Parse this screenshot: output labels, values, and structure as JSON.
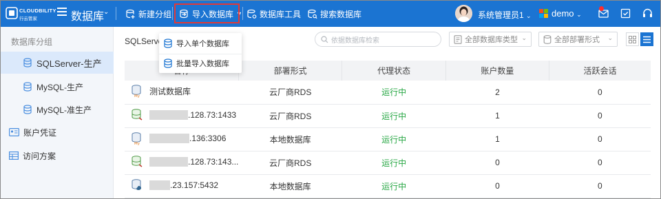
{
  "brand": {
    "name": "CLOUDBILITY",
    "sub": "行云管家"
  },
  "app": {
    "title": "数据库"
  },
  "toolbar": {
    "new_group": "新建分组",
    "import_db": "导入数据库",
    "db_tools": "数据库工具",
    "search_db": "搜索数据库"
  },
  "user": {
    "name": "系统管理员1"
  },
  "tenant": {
    "name": "demo"
  },
  "sidebar": {
    "heading": "数据库分组",
    "groups": [
      {
        "label": "SQLServer-生产"
      },
      {
        "label": "MySQL-生产"
      },
      {
        "label": "MySQL-准生产"
      }
    ],
    "credentials": "账户凭证",
    "access": "访问方案"
  },
  "main": {
    "breadcrumb": "SQLServer-生产",
    "search_placeholder": "依据数据库检索",
    "filter_type": "全部数据库类型",
    "filter_deploy": "全部部署形式"
  },
  "dropdown": {
    "single": "导入单个数据库",
    "batch": "批量导入数据库"
  },
  "table": {
    "headers": [
      "名称",
      "部署形式",
      "代理状态",
      "账户数量",
      "活跃会话"
    ],
    "rows": [
      {
        "name": "测试数据库",
        "deploy": "云厂商RDS",
        "status": "运行中",
        "accounts": "2",
        "sessions": "0"
      },
      {
        "name": ".128.73:1433",
        "deploy": "云厂商RDS",
        "status": "运行中",
        "accounts": "1",
        "sessions": "0"
      },
      {
        "name": ".136:3306",
        "deploy": "本地数据库",
        "status": "运行中",
        "accounts": "1",
        "sessions": "0"
      },
      {
        "name": ".128.73:143...",
        "deploy": "云厂商RDS",
        "status": "运行中",
        "accounts": "0",
        "sessions": "0"
      },
      {
        "name": ".23.157:5432",
        "deploy": "本地数据库",
        "status": "运行中",
        "accounts": "0",
        "sessions": "0"
      }
    ]
  },
  "colors": {
    "topbar": "#1b74d2",
    "active_row": "#dbe9fb",
    "running": "#27a744",
    "highlight": "#e53935"
  }
}
